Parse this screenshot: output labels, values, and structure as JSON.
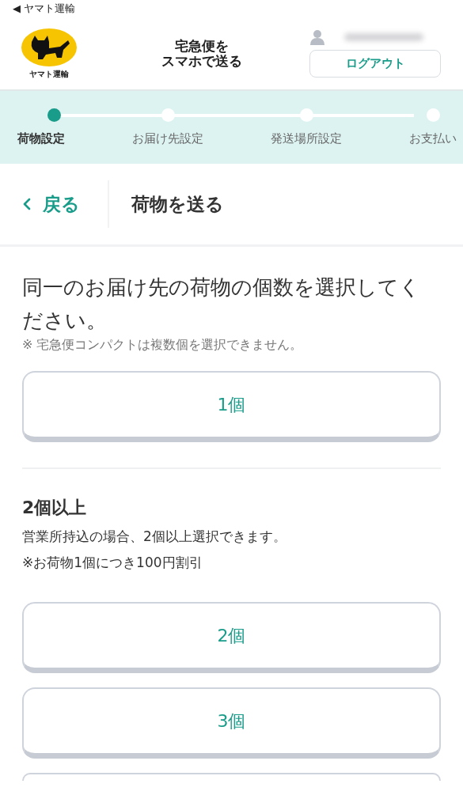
{
  "status_bar": {
    "back_app": "◀ ヤマト運輸"
  },
  "header": {
    "logo_text": "ヤマト運輸",
    "title_lines": [
      "宅急便を",
      "スマホで送る"
    ],
    "logout": "ログアウト"
  },
  "steps": [
    {
      "label": "荷物設定",
      "selected": true
    },
    {
      "label": "お届け先設定",
      "selected": false
    },
    {
      "label": "発送場所設定",
      "selected": false
    },
    {
      "label": "お支払い",
      "selected": false
    }
  ],
  "nav": {
    "back": "戻る",
    "title": "荷物を送る"
  },
  "question": {
    "text": "同一のお届け先の荷物の個数を選択してください。",
    "note": "※ 宅急便コンパクトは複数個を選択できません。"
  },
  "single_options": [
    {
      "kind": "full",
      "label": "1個"
    }
  ],
  "multi": {
    "heading": "2個以上",
    "lines": [
      "営業所持込の場合、2個以上選択できます。",
      "※お荷物1個につき100円割引"
    ]
  },
  "multi_options": [
    {
      "kind": "full",
      "label": "2個"
    },
    {
      "kind": "full",
      "label": "3個"
    },
    {
      "kind": "cut_off"
    }
  ]
}
